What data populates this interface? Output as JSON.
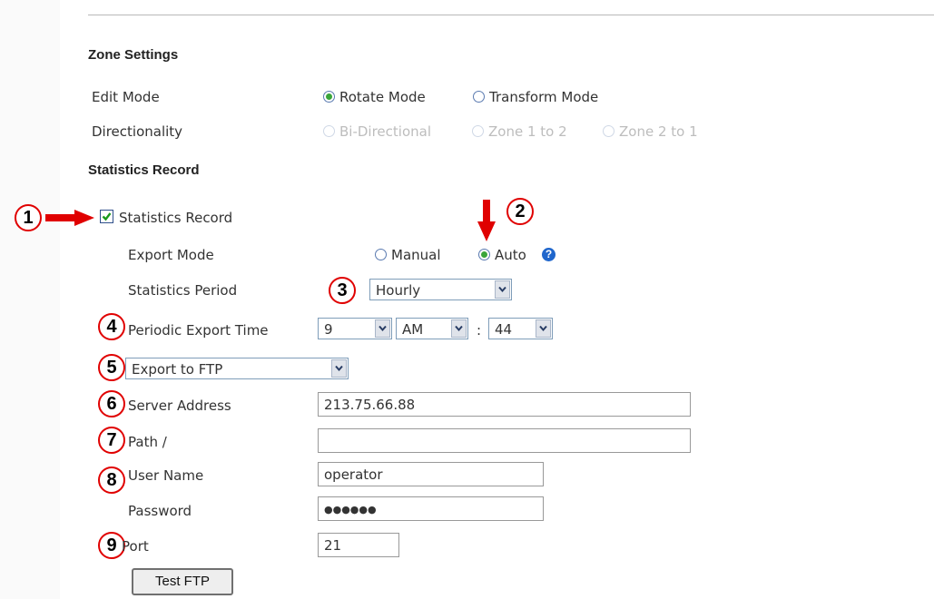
{
  "zone_settings": {
    "title": "Zone Settings",
    "edit_mode": {
      "label": "Edit Mode",
      "options": [
        "Rotate Mode",
        "Transform Mode"
      ],
      "selected": "Rotate Mode"
    },
    "directionality": {
      "label": "Directionality",
      "options": [
        "Bi-Directional",
        "Zone 1 to 2",
        "Zone 2 to 1"
      ],
      "disabled": true
    }
  },
  "statistics_record": {
    "title": "Statistics Record",
    "checkbox_label": "Statistics Record",
    "checked": true,
    "export_mode": {
      "label": "Export Mode",
      "options": [
        "Manual",
        "Auto"
      ],
      "selected": "Auto",
      "help_icon": "question-icon"
    },
    "statistics_period": {
      "label": "Statistics Period",
      "value": "Hourly"
    },
    "periodic_export_time": {
      "label": "Periodic Export Time",
      "hour": "9",
      "ampm": "AM",
      "separator": ":",
      "minute": "44"
    },
    "export_target": "Export to FTP",
    "server_address": {
      "label": "Server Address",
      "value": "213.75.66.88"
    },
    "path": {
      "label": "Path /",
      "value": ""
    },
    "user_name": {
      "label": "User Name",
      "value": "operator"
    },
    "password": {
      "label": "Password",
      "value": "●●●●●●"
    },
    "port": {
      "label": "Port",
      "value": "21"
    },
    "test_button": "Test FTP"
  },
  "callouts": [
    "1",
    "2",
    "3",
    "4",
    "5",
    "6",
    "7",
    "8",
    "9"
  ],
  "colors": {
    "callout_border": "#e00000",
    "arrow": "#e00000",
    "radio_selected": "#3aa53a",
    "help_icon": "#1f66cc"
  }
}
